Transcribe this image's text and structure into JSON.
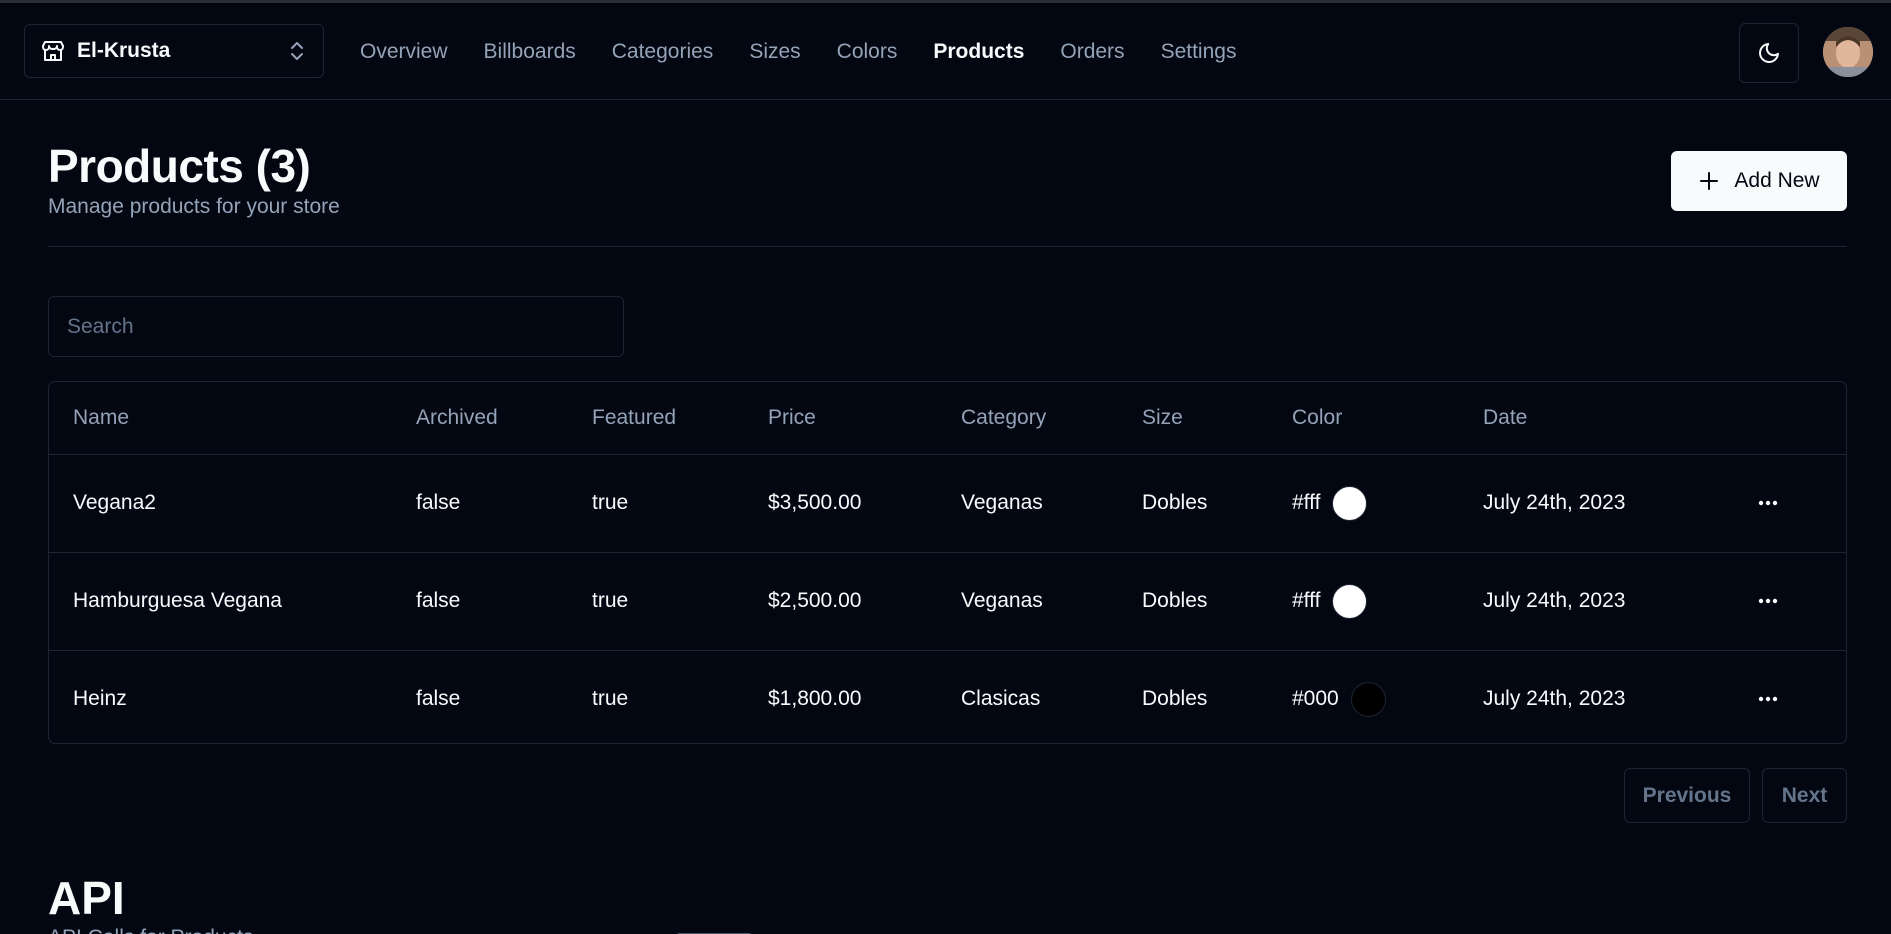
{
  "store": {
    "name": "El-Krusta"
  },
  "nav": {
    "links": [
      "Overview",
      "Billboards",
      "Categories",
      "Sizes",
      "Colors",
      "Products",
      "Orders",
      "Settings"
    ],
    "active": "Products"
  },
  "header": {
    "title": "Products (3)",
    "subtitle": "Manage products for your store",
    "add_label": "Add New"
  },
  "search": {
    "placeholder": "Search",
    "value": ""
  },
  "table": {
    "columns": [
      "Name",
      "Archived",
      "Featured",
      "Price",
      "Category",
      "Size",
      "Color",
      "Date"
    ],
    "rows": [
      {
        "name": "Vegana2",
        "archived": "false",
        "featured": "true",
        "price": "$3,500.00",
        "category": "Veganas",
        "size": "Dobles",
        "color": "#fff",
        "date": "July 24th, 2023"
      },
      {
        "name": "Hamburguesa Vegana",
        "archived": "false",
        "featured": "true",
        "price": "$2,500.00",
        "category": "Veganas",
        "size": "Dobles",
        "color": "#fff",
        "date": "July 24th, 2023"
      },
      {
        "name": "Heinz",
        "archived": "false",
        "featured": "true",
        "price": "$1,800.00",
        "category": "Clasicas",
        "size": "Dobles",
        "color": "#000",
        "date": "July 24th, 2023"
      }
    ]
  },
  "pagination": {
    "previous": "Previous",
    "next": "Next"
  },
  "api": {
    "title": "API",
    "subtitle": "API Calls for Products"
  },
  "colors": {
    "background": "#030711",
    "border": "#1e2532",
    "muted": "#94a3b8",
    "foreground": "#f8fafc"
  }
}
